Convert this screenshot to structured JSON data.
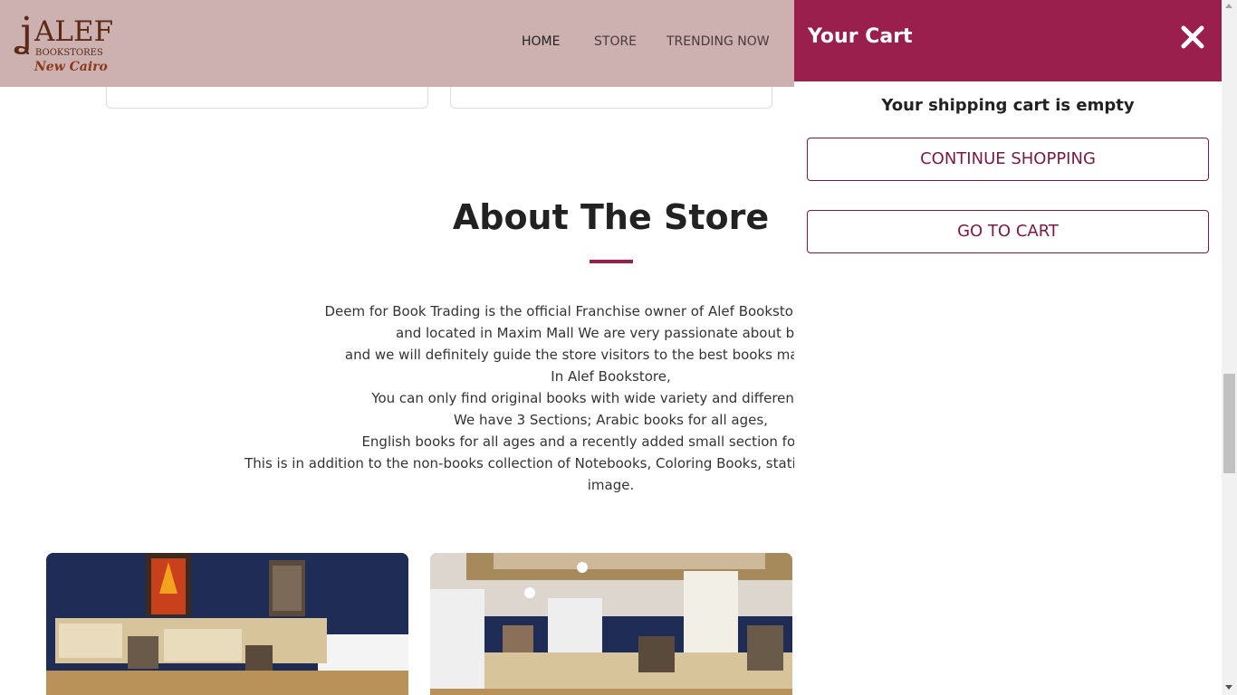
{
  "header": {
    "logo": {
      "mark": "ʝ",
      "name": "ALEF",
      "subtitle": "BOOKSTORES",
      "city": "New Cairo"
    },
    "nav": [
      {
        "label": "HOME",
        "active": true
      },
      {
        "label": "STORE",
        "active": false
      },
      {
        "label": "TRENDING NOW",
        "active": false
      }
    ]
  },
  "about": {
    "title": "About The Store",
    "lines": [
      "Deem for Book Trading is the official Franchise owner of Alef Bookstore in New Cairo",
      "and located in Maxim Mall We are very passionate about books",
      "and we will definitely guide the store visitors to the best books matching their",
      "In Alef Bookstore,",
      "You can only find original books with wide variety and different genres",
      "We have 3 Sections; Arabic books for all ages,",
      "English books for all ages and a recently added small section for French (",
      "This is in addition to the non-books collection of Notebooks, Coloring Books, stationery, games and Laptops",
      "image."
    ]
  },
  "cart": {
    "title": "Your Cart",
    "close_icon": "close-icon",
    "empty_message": "Your shipping cart is empty",
    "continue_label": "CONTINUE SHOPPING",
    "go_to_cart_label": "GO TO CART"
  },
  "colors": {
    "header_bg": "#cdb0b0",
    "brand": "#9b1f4d",
    "brand_dark": "#7a1a44"
  }
}
